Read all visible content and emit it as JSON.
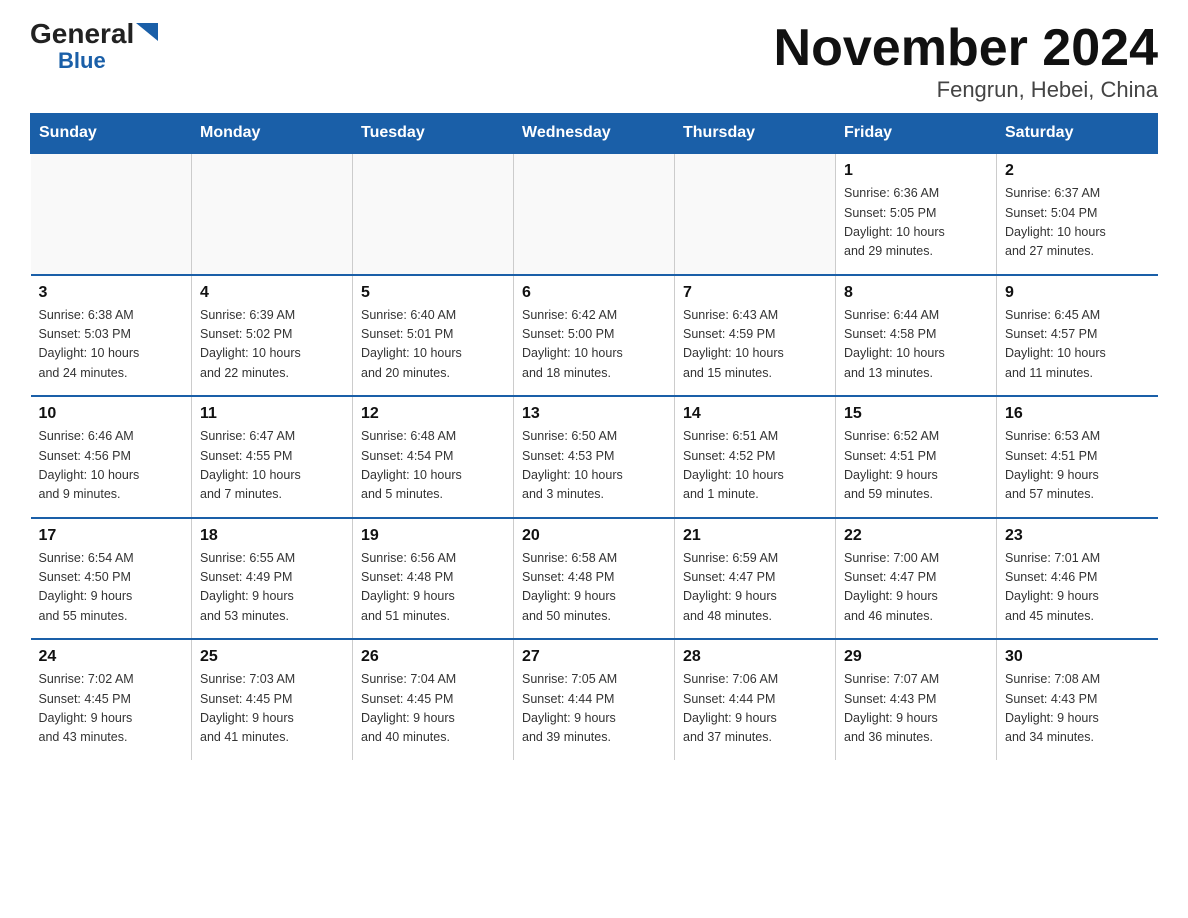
{
  "logo": {
    "general": "General",
    "triangle_symbol": "▶",
    "blue": "Blue"
  },
  "title": "November 2024",
  "subtitle": "Fengrun, Hebei, China",
  "weekdays": [
    "Sunday",
    "Monday",
    "Tuesday",
    "Wednesday",
    "Thursday",
    "Friday",
    "Saturday"
  ],
  "weeks": [
    [
      {
        "day": "",
        "info": ""
      },
      {
        "day": "",
        "info": ""
      },
      {
        "day": "",
        "info": ""
      },
      {
        "day": "",
        "info": ""
      },
      {
        "day": "",
        "info": ""
      },
      {
        "day": "1",
        "info": "Sunrise: 6:36 AM\nSunset: 5:05 PM\nDaylight: 10 hours\nand 29 minutes."
      },
      {
        "day": "2",
        "info": "Sunrise: 6:37 AM\nSunset: 5:04 PM\nDaylight: 10 hours\nand 27 minutes."
      }
    ],
    [
      {
        "day": "3",
        "info": "Sunrise: 6:38 AM\nSunset: 5:03 PM\nDaylight: 10 hours\nand 24 minutes."
      },
      {
        "day": "4",
        "info": "Sunrise: 6:39 AM\nSunset: 5:02 PM\nDaylight: 10 hours\nand 22 minutes."
      },
      {
        "day": "5",
        "info": "Sunrise: 6:40 AM\nSunset: 5:01 PM\nDaylight: 10 hours\nand 20 minutes."
      },
      {
        "day": "6",
        "info": "Sunrise: 6:42 AM\nSunset: 5:00 PM\nDaylight: 10 hours\nand 18 minutes."
      },
      {
        "day": "7",
        "info": "Sunrise: 6:43 AM\nSunset: 4:59 PM\nDaylight: 10 hours\nand 15 minutes."
      },
      {
        "day": "8",
        "info": "Sunrise: 6:44 AM\nSunset: 4:58 PM\nDaylight: 10 hours\nand 13 minutes."
      },
      {
        "day": "9",
        "info": "Sunrise: 6:45 AM\nSunset: 4:57 PM\nDaylight: 10 hours\nand 11 minutes."
      }
    ],
    [
      {
        "day": "10",
        "info": "Sunrise: 6:46 AM\nSunset: 4:56 PM\nDaylight: 10 hours\nand 9 minutes."
      },
      {
        "day": "11",
        "info": "Sunrise: 6:47 AM\nSunset: 4:55 PM\nDaylight: 10 hours\nand 7 minutes."
      },
      {
        "day": "12",
        "info": "Sunrise: 6:48 AM\nSunset: 4:54 PM\nDaylight: 10 hours\nand 5 minutes."
      },
      {
        "day": "13",
        "info": "Sunrise: 6:50 AM\nSunset: 4:53 PM\nDaylight: 10 hours\nand 3 minutes."
      },
      {
        "day": "14",
        "info": "Sunrise: 6:51 AM\nSunset: 4:52 PM\nDaylight: 10 hours\nand 1 minute."
      },
      {
        "day": "15",
        "info": "Sunrise: 6:52 AM\nSunset: 4:51 PM\nDaylight: 9 hours\nand 59 minutes."
      },
      {
        "day": "16",
        "info": "Sunrise: 6:53 AM\nSunset: 4:51 PM\nDaylight: 9 hours\nand 57 minutes."
      }
    ],
    [
      {
        "day": "17",
        "info": "Sunrise: 6:54 AM\nSunset: 4:50 PM\nDaylight: 9 hours\nand 55 minutes."
      },
      {
        "day": "18",
        "info": "Sunrise: 6:55 AM\nSunset: 4:49 PM\nDaylight: 9 hours\nand 53 minutes."
      },
      {
        "day": "19",
        "info": "Sunrise: 6:56 AM\nSunset: 4:48 PM\nDaylight: 9 hours\nand 51 minutes."
      },
      {
        "day": "20",
        "info": "Sunrise: 6:58 AM\nSunset: 4:48 PM\nDaylight: 9 hours\nand 50 minutes."
      },
      {
        "day": "21",
        "info": "Sunrise: 6:59 AM\nSunset: 4:47 PM\nDaylight: 9 hours\nand 48 minutes."
      },
      {
        "day": "22",
        "info": "Sunrise: 7:00 AM\nSunset: 4:47 PM\nDaylight: 9 hours\nand 46 minutes."
      },
      {
        "day": "23",
        "info": "Sunrise: 7:01 AM\nSunset: 4:46 PM\nDaylight: 9 hours\nand 45 minutes."
      }
    ],
    [
      {
        "day": "24",
        "info": "Sunrise: 7:02 AM\nSunset: 4:45 PM\nDaylight: 9 hours\nand 43 minutes."
      },
      {
        "day": "25",
        "info": "Sunrise: 7:03 AM\nSunset: 4:45 PM\nDaylight: 9 hours\nand 41 minutes."
      },
      {
        "day": "26",
        "info": "Sunrise: 7:04 AM\nSunset: 4:45 PM\nDaylight: 9 hours\nand 40 minutes."
      },
      {
        "day": "27",
        "info": "Sunrise: 7:05 AM\nSunset: 4:44 PM\nDaylight: 9 hours\nand 39 minutes."
      },
      {
        "day": "28",
        "info": "Sunrise: 7:06 AM\nSunset: 4:44 PM\nDaylight: 9 hours\nand 37 minutes."
      },
      {
        "day": "29",
        "info": "Sunrise: 7:07 AM\nSunset: 4:43 PM\nDaylight: 9 hours\nand 36 minutes."
      },
      {
        "day": "30",
        "info": "Sunrise: 7:08 AM\nSunset: 4:43 PM\nDaylight: 9 hours\nand 34 minutes."
      }
    ]
  ]
}
